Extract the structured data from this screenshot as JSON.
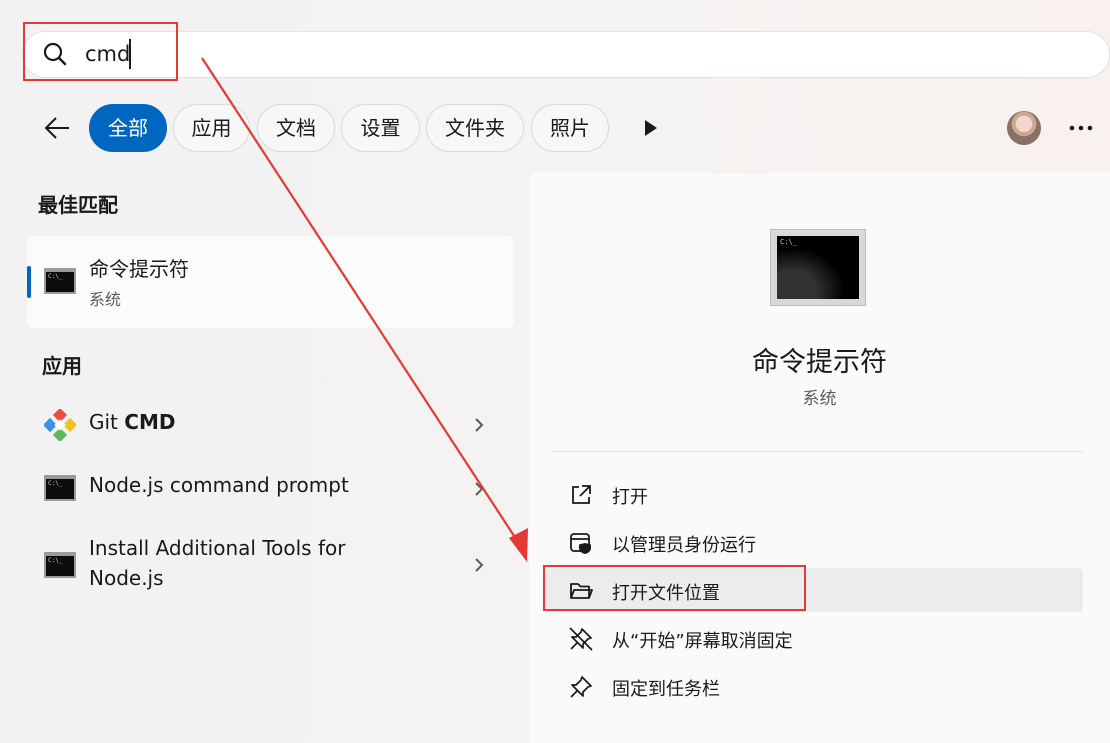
{
  "search": {
    "query": "cmd"
  },
  "filters": {
    "chips": [
      {
        "label": "全部",
        "active": true
      },
      {
        "label": "应用"
      },
      {
        "label": "文档"
      },
      {
        "label": "设置"
      },
      {
        "label": "文件夹"
      },
      {
        "label": "照片"
      }
    ]
  },
  "best_match": {
    "heading": "最佳匹配",
    "title": "命令提示符",
    "subtitle": "系统"
  },
  "apps": {
    "heading": "应用",
    "items": [
      {
        "title_prefix": "Git ",
        "title_bold": "CMD",
        "icon": "git-icon"
      },
      {
        "title": "Node.js command prompt",
        "icon": "cmd-icon"
      },
      {
        "title_line1": "Install Additional Tools for",
        "title_line2": "Node.js",
        "icon": "cmd-icon"
      }
    ]
  },
  "details": {
    "name": "命令提示符",
    "category": "系统",
    "actions": [
      {
        "label": "打开",
        "icon": "open-external-icon"
      },
      {
        "label": "以管理员身份运行",
        "icon": "shield-icon"
      },
      {
        "label": "打开文件位置",
        "icon": "folder-icon"
      },
      {
        "label": "从“开始”屏幕取消固定",
        "icon": "unpin-icon"
      },
      {
        "label": "固定到任务栏",
        "icon": "pin-icon"
      }
    ]
  },
  "colors": {
    "accent": "#0067c0",
    "annotation": "#e53935"
  }
}
